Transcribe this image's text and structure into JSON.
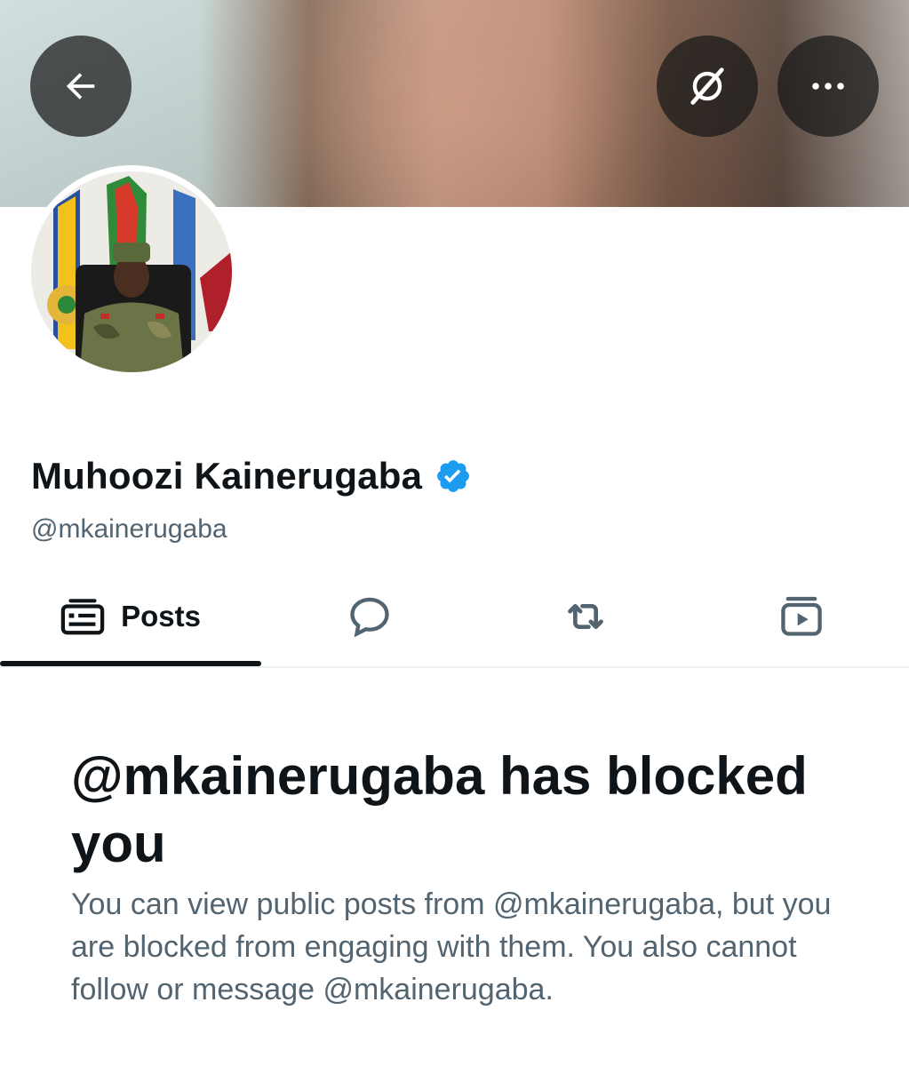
{
  "profile": {
    "display_name": "Muhoozi Kainerugaba",
    "handle": "@mkainerugaba",
    "verified": true
  },
  "header": {
    "back_icon": "arrow-left-icon",
    "grok_icon": "grok-icon",
    "more_icon": "more-horizontal-icon"
  },
  "tabs": [
    {
      "label": "Posts",
      "icon": "posts-icon",
      "selected": true
    },
    {
      "label": "",
      "icon": "reply-icon",
      "selected": false
    },
    {
      "label": "",
      "icon": "repost-icon",
      "selected": false
    },
    {
      "label": "",
      "icon": "media-icon",
      "selected": false
    }
  ],
  "blocked": {
    "title": "@mkainerugaba has blocked you",
    "description": "You can view public posts from @mkainerugaba, but you are blocked from engaging with them. You also cannot follow or message @mkainerugaba."
  },
  "colors": {
    "text_primary": "#0f1419",
    "text_secondary": "#536471",
    "verified_blue": "#1d9bf0",
    "overlay_button": "#181818"
  }
}
